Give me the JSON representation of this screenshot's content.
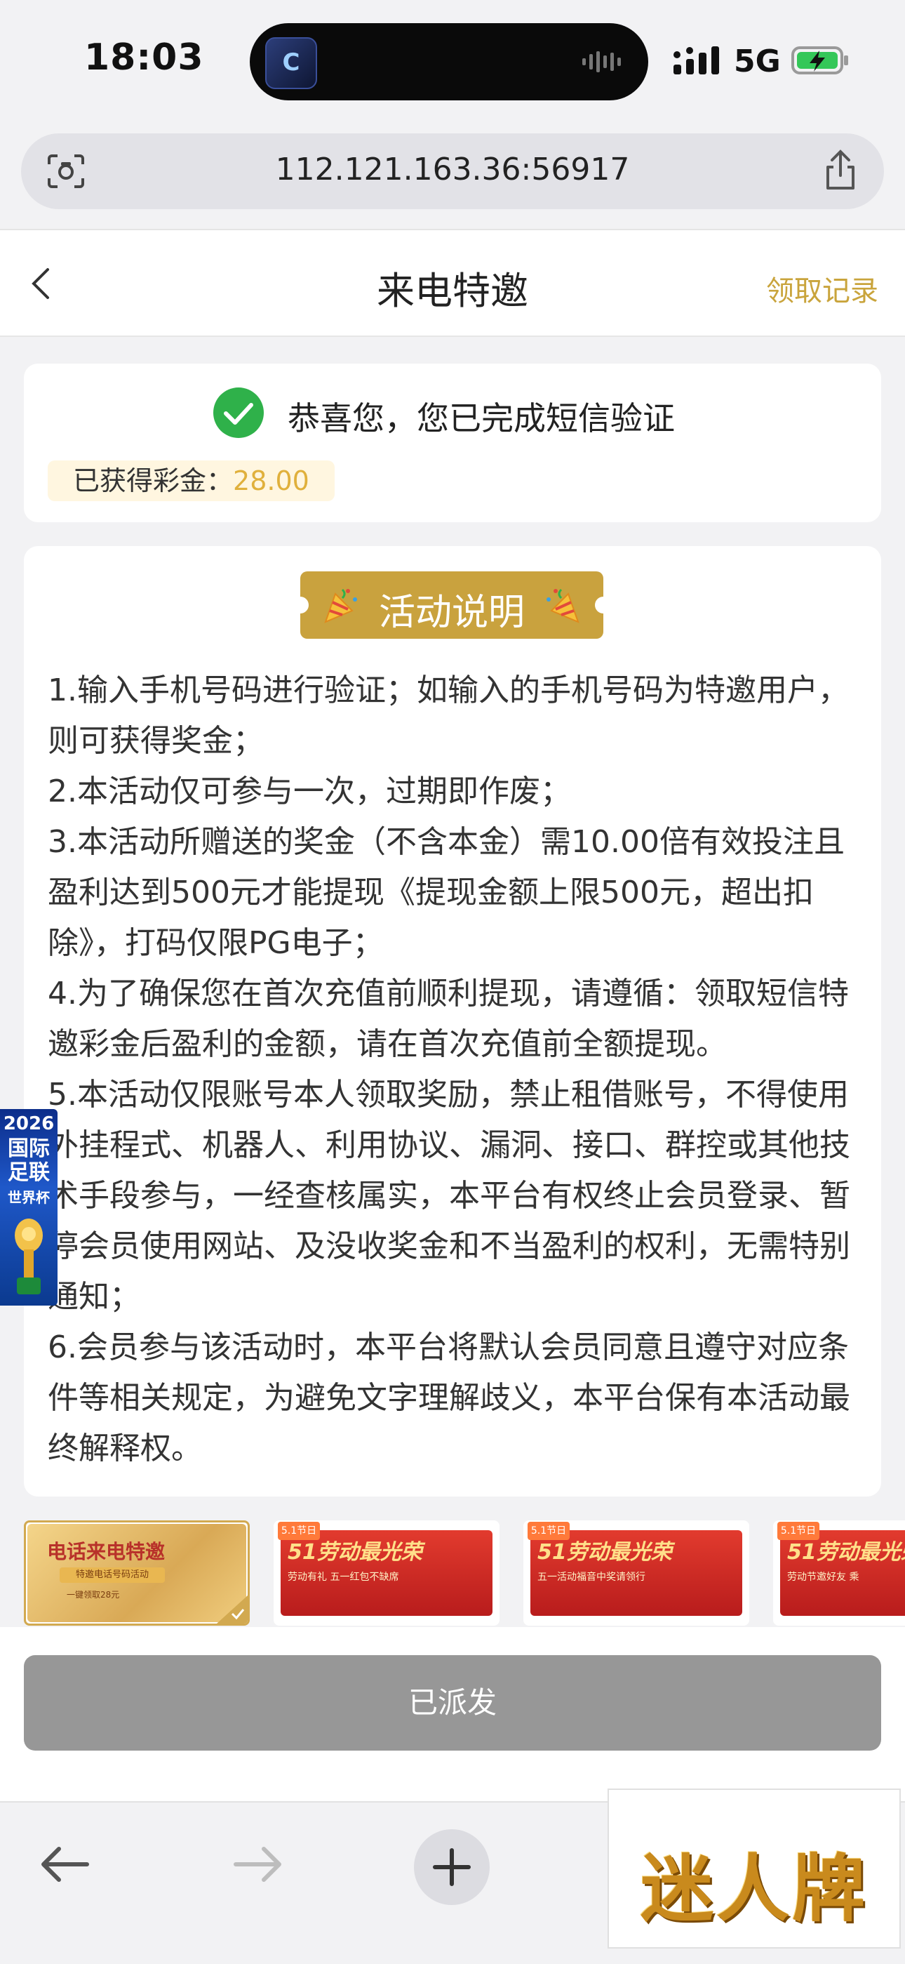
{
  "status_bar": {
    "time": "18:03",
    "island_app_glyph": "C",
    "network": "5G"
  },
  "browser": {
    "url": "112.121.163.36:56917"
  },
  "header": {
    "title": "来电特邀",
    "record_link": "领取记录"
  },
  "success_card": {
    "message": "恭喜您，您已完成短信验证",
    "bonus_label": "已获得彩金：",
    "bonus_value": "28.00"
  },
  "rules_card": {
    "badge_title": "活动说明",
    "rules": [
      "1.输入手机号码进行验证；如输入的手机号码为特邀用户，则可获得奖金；",
      "2.本活动仅可参与一次，过期即作废；",
      "3.本活动所赠送的奖金（不含本金）需10.00倍有效投注且盈利达到500元才能提现《提现金额上限500元，超出扣除》，打码仅限PG电子；",
      "4.为了确保您在首次充值前顺利提现，请遵循：领取短信特邀彩金后盈利的金额，请在首次充值前全额提现。",
      "5.本活动仅限账号本人领取奖励，禁止租借账号，不得使用外挂程式、机器人、利用协议、漏洞、接口、群控或其他技术手段参与，一经查核属实，本平台有权终止会员登录、暂停会员使用网站、及没收奖金和不当盈利的权利，无需特别通知；",
      "6.会员参与该活动时，本平台将默认会员同意且遵守对应条件等相关规定，为避免文字理解歧义，本平台保有本活动最终解释权。"
    ]
  },
  "side_ad": {
    "year": "2026",
    "line1": "国际",
    "line2": "足联",
    "line3": "世界杯"
  },
  "banners": [
    {
      "title": "电话来电特邀",
      "sub": "特邀电话号码活动",
      "sub2": "一键领取28元",
      "selected": true
    },
    {
      "tag": "5.1节日",
      "title": "51劳动最光荣",
      "sub": "劳动有礼 五一红包不缺席"
    },
    {
      "tag": "5.1节日",
      "title": "51劳动最光荣",
      "sub": "五一活动福音中奖请领行"
    },
    {
      "tag": "5.1节日",
      "title": "51劳动最光荣",
      "sub": "劳动节邀好友 乘"
    }
  ],
  "action_button": {
    "label": "已派发"
  },
  "watermark_logo": {
    "text": "迷人牌"
  },
  "colors": {
    "accent_gold": "#c9a23e",
    "success_green": "#2fb14a",
    "button_disabled": "#979797"
  }
}
